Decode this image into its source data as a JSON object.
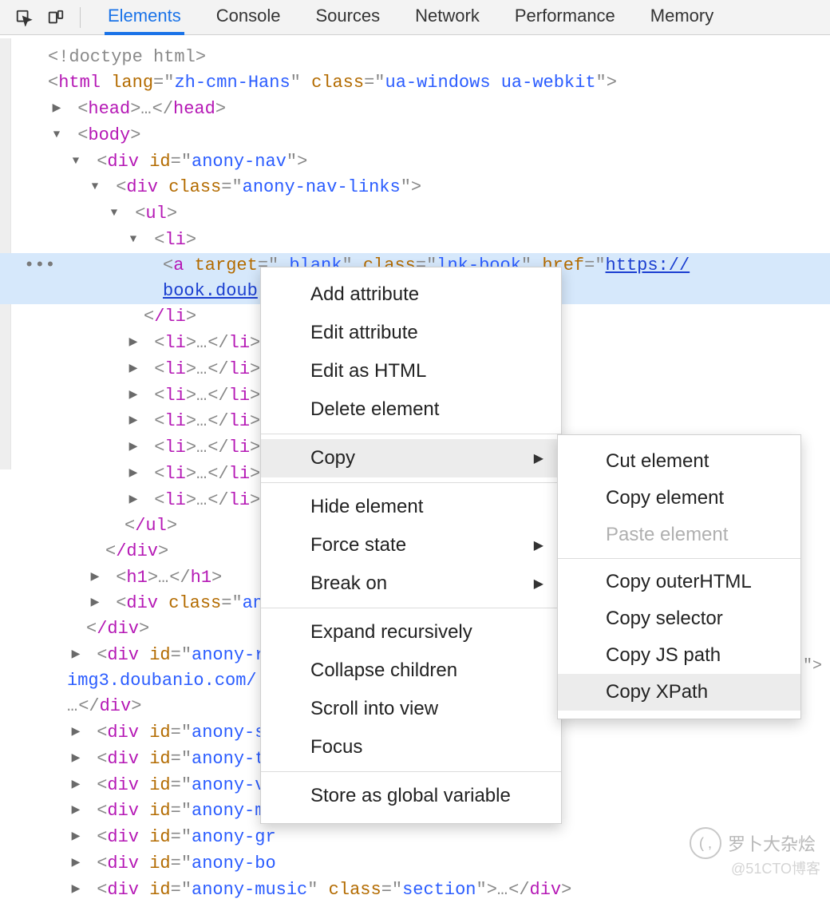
{
  "tabs": {
    "elements": "Elements",
    "console": "Console",
    "sources": "Sources",
    "network": "Network",
    "performance": "Performance",
    "memory": "Memory"
  },
  "dom": {
    "doctype": "<!doctype html>",
    "html_lang": "zh-cmn-Hans",
    "html_class": "ua-windows ua-webkit",
    "head_open": "head",
    "body_open": "body",
    "div_anony_nav_id": "anony-nav",
    "div_anony_nav_links_class": "anony-nav-links",
    "ul": "ul",
    "li": "li",
    "a_target": "_blank",
    "a_class": "lnk-book",
    "a_href_part1": "https://",
    "a_href_part2": "book.doub",
    "li_close": "/li",
    "ul_close": "/ul",
    "div_close": "/div",
    "h1": "h1",
    "div_anc_prefix": "anc",
    "div_anony_re_id_prefix": "anony-re",
    "img_host_fragment": "img3.doubanio.com/",
    "div_anony_sn": "anony-sn",
    "div_anony_ti": "anony-ti",
    "div_anony_vi": "anony-vi",
    "div_anony_mo": "anony-mo",
    "div_anony_gr": "anony-gr",
    "div_anony_bo": "anony-bo",
    "div_anony_music": "anony-music",
    "section_class": "section"
  },
  "context_menu": {
    "add_attribute": "Add attribute",
    "edit_attribute": "Edit attribute",
    "edit_as_html": "Edit as HTML",
    "delete_element": "Delete element",
    "copy": "Copy",
    "hide_element": "Hide element",
    "force_state": "Force state",
    "break_on": "Break on",
    "expand_recursively": "Expand recursively",
    "collapse_children": "Collapse children",
    "scroll_into_view": "Scroll into view",
    "focus": "Focus",
    "store_as_global": "Store as global variable"
  },
  "copy_submenu": {
    "cut_element": "Cut element",
    "copy_element": "Copy element",
    "paste_element": "Paste element",
    "copy_outerhtml": "Copy outerHTML",
    "copy_selector": "Copy selector",
    "copy_js_path": "Copy JS path",
    "copy_xpath": "Copy XPath"
  },
  "watermark": {
    "main": "罗卜大杂烩",
    "sub": "@51CTO博客"
  }
}
